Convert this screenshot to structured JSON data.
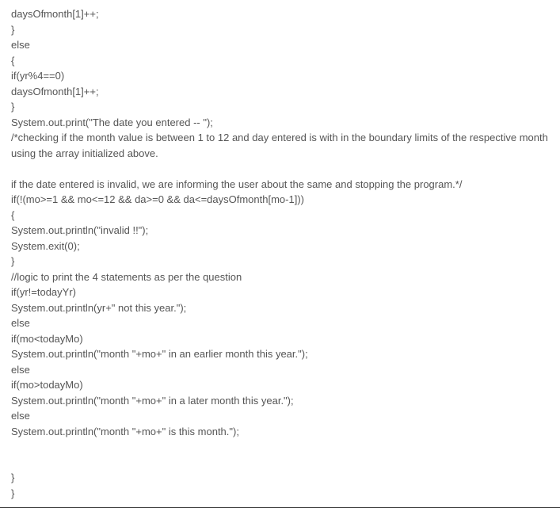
{
  "code_lines": [
    "daysOfmonth[1]++;",
    "}",
    "else",
    "{",
    "if(yr%4==0)",
    "daysOfmonth[1]++;",
    "}",
    "System.out.print(\"The date you entered -- \");",
    "/*checking if the month value is between 1 to 12 and day entered is with in the boundary limits of the respective month using the array initialized above.",
    "",
    "if the date entered is invalid, we are informing the user about the same and stopping the program.*/",
    "if(!(mo>=1 && mo<=12 && da>=0 && da<=daysOfmonth[mo-1]))",
    "{",
    "System.out.println(\"invalid !!\");",
    "System.exit(0);",
    "}",
    "//logic to print the 4 statements as per the question",
    "if(yr!=todayYr)",
    "System.out.println(yr+\" not this year.\");",
    "else",
    "if(mo<todayMo)",
    "System.out.println(\"month \"+mo+\" in an earlier month this year.\");",
    "else",
    "if(mo>todayMo)",
    "System.out.println(\"month \"+mo+\" in a later month this year.\");",
    "else",
    "System.out.println(\"month \"+mo+\" is this month.\");",
    "",
    "",
    "}",
    "}"
  ]
}
